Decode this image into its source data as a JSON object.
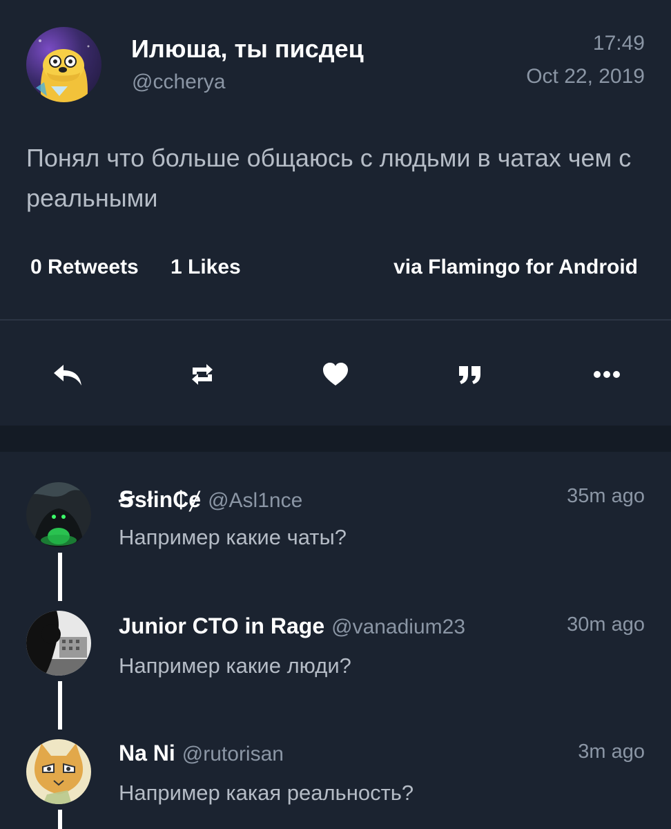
{
  "tweet": {
    "author_name": "Илюша, ты писдец",
    "author_handle": "@ccherya",
    "time": "17:49",
    "date": "Oct 22, 2019",
    "text": "Понял что больше общаюсь с людьми в чатах чем с реальными",
    "retweets": "0 Retweets",
    "likes": "1 Likes",
    "via": "via Flamingo for Android"
  },
  "actions": [
    {
      "icon": "reply-icon"
    },
    {
      "icon": "retweet-icon"
    },
    {
      "icon": "heart-icon"
    },
    {
      "icon": "quote-icon"
    },
    {
      "icon": "more-icon"
    }
  ],
  "replies": [
    {
      "name": "Ꞩsłin₵ɇ",
      "handle": "@Asl1nce",
      "time": "35m ago",
      "text": "Например какие чаты?"
    },
    {
      "name": "Junior CTO in Rage",
      "handle": "@vanadium23",
      "time": "30m ago",
      "text": "Например какие люди?"
    },
    {
      "name": "Na Ni",
      "handle": "@rutorisan",
      "time": "3m ago",
      "text": "Например какая реальность?"
    }
  ],
  "colors": {
    "background": "#1b2330",
    "section_gap": "#141b25",
    "primary_text": "#ffffff",
    "secondary_text": "#8b96a5",
    "body_text": "#b5bcc6"
  }
}
